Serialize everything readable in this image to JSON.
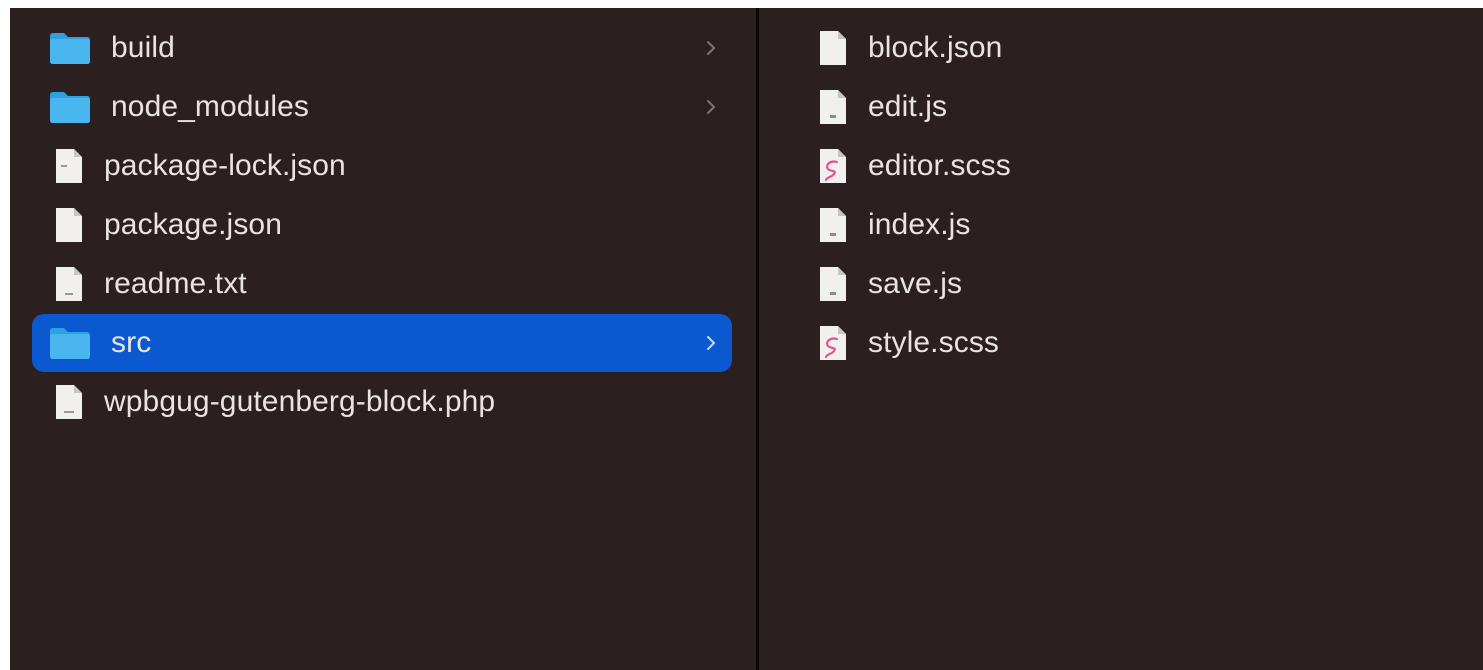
{
  "colors": {
    "background": "#2b1f1f",
    "selection": "#0a59d0",
    "folder": "#3fb0ec",
    "text": "#e9e4e3",
    "sass_accent": "#e0558c"
  },
  "left_column": {
    "items": [
      {
        "label": "build",
        "icon": "folder-icon",
        "has_children": true
      },
      {
        "label": "node_modules",
        "icon": "folder-icon",
        "has_children": true
      },
      {
        "label": "package-lock.json",
        "icon": "json-file-icon",
        "has_children": false
      },
      {
        "label": "package.json",
        "icon": "json-file-icon",
        "has_children": false
      },
      {
        "label": "readme.txt",
        "icon": "text-file-icon",
        "has_children": false
      },
      {
        "label": "src",
        "icon": "folder-icon",
        "has_children": true,
        "selected": true
      },
      {
        "label": "wpbgug-gutenberg-block.php",
        "icon": "php-file-icon",
        "has_children": false
      }
    ]
  },
  "right_column": {
    "items": [
      {
        "label": "block.json",
        "icon": "json-file-icon"
      },
      {
        "label": "edit.js",
        "icon": "js-file-icon"
      },
      {
        "label": "editor.scss",
        "icon": "scss-file-icon"
      },
      {
        "label": "index.js",
        "icon": "js-file-icon"
      },
      {
        "label": "save.js",
        "icon": "js-file-icon"
      },
      {
        "label": "style.scss",
        "icon": "scss-file-icon"
      }
    ]
  }
}
